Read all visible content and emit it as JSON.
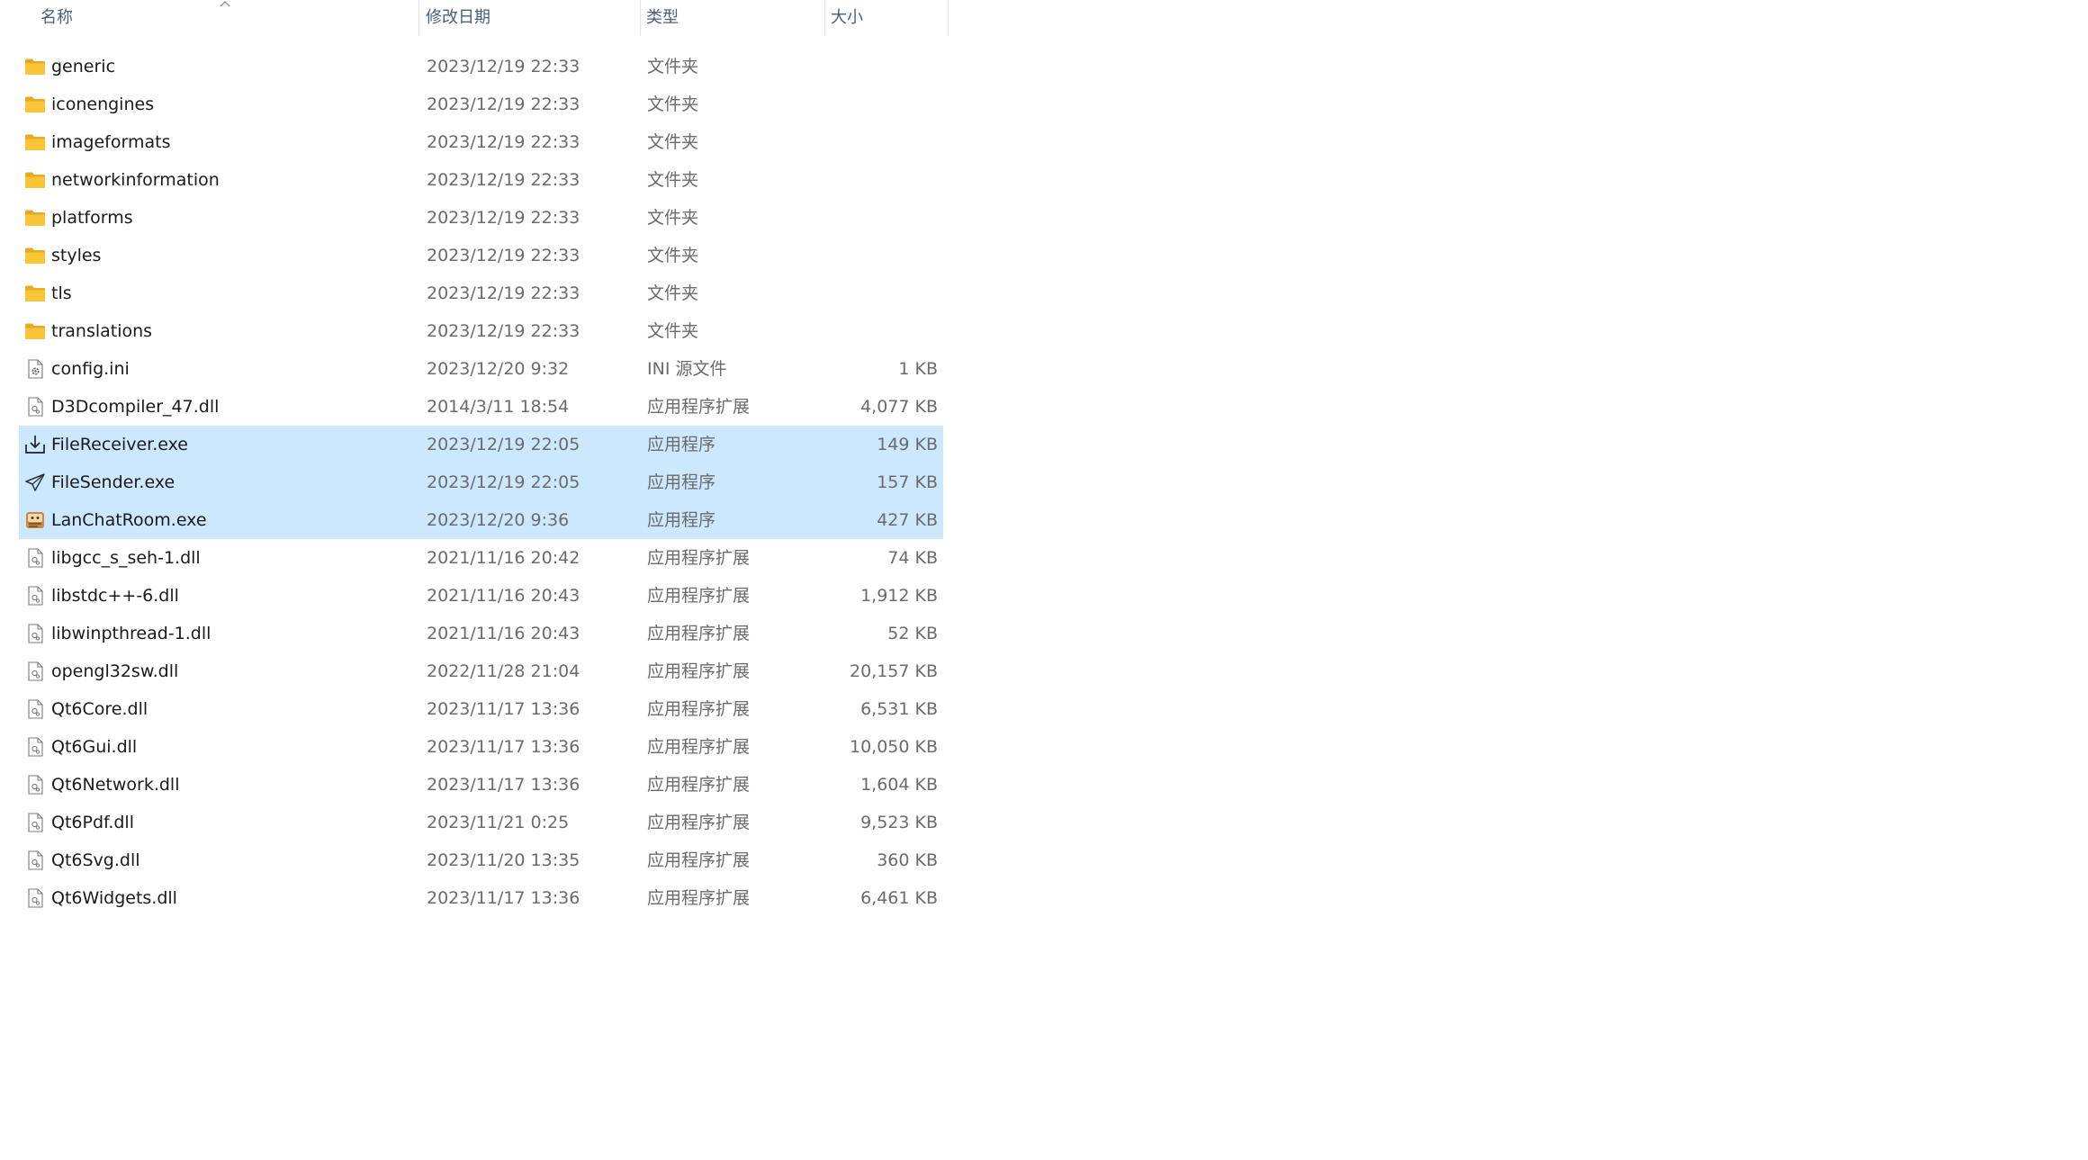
{
  "header": {
    "name_label": "名称",
    "date_label": "修改日期",
    "type_label": "类型",
    "size_label": "大小",
    "sort_icon": "chevron-up-icon"
  },
  "colors": {
    "folder": "#f8c537",
    "selection": "#cce8ff",
    "header_text": "#4c607a"
  },
  "rows": [
    {
      "name": "generic",
      "date": "2023/12/19 22:33",
      "type": "文件夹",
      "size": "",
      "icon": "folder-icon",
      "selected": false
    },
    {
      "name": "iconengines",
      "date": "2023/12/19 22:33",
      "type": "文件夹",
      "size": "",
      "icon": "folder-icon",
      "selected": false
    },
    {
      "name": "imageformats",
      "date": "2023/12/19 22:33",
      "type": "文件夹",
      "size": "",
      "icon": "folder-icon",
      "selected": false
    },
    {
      "name": "networkinformation",
      "date": "2023/12/19 22:33",
      "type": "文件夹",
      "size": "",
      "icon": "folder-icon",
      "selected": false
    },
    {
      "name": "platforms",
      "date": "2023/12/19 22:33",
      "type": "文件夹",
      "size": "",
      "icon": "folder-icon",
      "selected": false
    },
    {
      "name": "styles",
      "date": "2023/12/19 22:33",
      "type": "文件夹",
      "size": "",
      "icon": "folder-icon",
      "selected": false
    },
    {
      "name": "tls",
      "date": "2023/12/19 22:33",
      "type": "文件夹",
      "size": "",
      "icon": "folder-icon",
      "selected": false
    },
    {
      "name": "translations",
      "date": "2023/12/19 22:33",
      "type": "文件夹",
      "size": "",
      "icon": "folder-icon",
      "selected": false
    },
    {
      "name": "config.ini",
      "date": "2023/12/20 9:32",
      "type": "INI 源文件",
      "size": "1 KB",
      "icon": "settings-file-icon",
      "selected": false
    },
    {
      "name": "D3Dcompiler_47.dll",
      "date": "2014/3/11 18:54",
      "type": "应用程序扩展",
      "size": "4,077 KB",
      "icon": "dll-file-icon",
      "selected": false
    },
    {
      "name": "FileReceiver.exe",
      "date": "2023/12/19 22:05",
      "type": "应用程序",
      "size": "149 KB",
      "icon": "download-tray-icon",
      "selected": true
    },
    {
      "name": "FileSender.exe",
      "date": "2023/12/19 22:05",
      "type": "应用程序",
      "size": "157 KB",
      "icon": "paper-plane-icon",
      "selected": true
    },
    {
      "name": "LanChatRoom.exe",
      "date": "2023/12/20 9:36",
      "type": "应用程序",
      "size": "427 KB",
      "icon": "chat-app-icon",
      "selected": true
    },
    {
      "name": "libgcc_s_seh-1.dll",
      "date": "2021/11/16 20:42",
      "type": "应用程序扩展",
      "size": "74 KB",
      "icon": "dll-file-icon",
      "selected": false
    },
    {
      "name": "libstdc++-6.dll",
      "date": "2021/11/16 20:43",
      "type": "应用程序扩展",
      "size": "1,912 KB",
      "icon": "dll-file-icon",
      "selected": false
    },
    {
      "name": "libwinpthread-1.dll",
      "date": "2021/11/16 20:43",
      "type": "应用程序扩展",
      "size": "52 KB",
      "icon": "dll-file-icon",
      "selected": false
    },
    {
      "name": "opengl32sw.dll",
      "date": "2022/11/28 21:04",
      "type": "应用程序扩展",
      "size": "20,157 KB",
      "icon": "dll-file-icon",
      "selected": false
    },
    {
      "name": "Qt6Core.dll",
      "date": "2023/11/17 13:36",
      "type": "应用程序扩展",
      "size": "6,531 KB",
      "icon": "dll-file-icon",
      "selected": false
    },
    {
      "name": "Qt6Gui.dll",
      "date": "2023/11/17 13:36",
      "type": "应用程序扩展",
      "size": "10,050 KB",
      "icon": "dll-file-icon",
      "selected": false
    },
    {
      "name": "Qt6Network.dll",
      "date": "2023/11/17 13:36",
      "type": "应用程序扩展",
      "size": "1,604 KB",
      "icon": "dll-file-icon",
      "selected": false
    },
    {
      "name": "Qt6Pdf.dll",
      "date": "2023/11/21 0:25",
      "type": "应用程序扩展",
      "size": "9,523 KB",
      "icon": "dll-file-icon",
      "selected": false
    },
    {
      "name": "Qt6Svg.dll",
      "date": "2023/11/20 13:35",
      "type": "应用程序扩展",
      "size": "360 KB",
      "icon": "dll-file-icon",
      "selected": false
    },
    {
      "name": "Qt6Widgets.dll",
      "date": "2023/11/17 13:36",
      "type": "应用程序扩展",
      "size": "6,461 KB",
      "icon": "dll-file-icon",
      "selected": false
    }
  ]
}
